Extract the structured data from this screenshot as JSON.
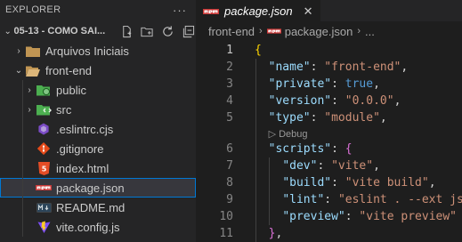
{
  "explorer": {
    "title": "EXPLORER",
    "more_label": "···",
    "project_name": "05-13 - COMO SAI...",
    "actions": [
      "new-file-icon",
      "new-folder-icon",
      "refresh-icon",
      "collapse-all-icon"
    ],
    "tree": [
      {
        "label": "Arquivos Iniciais",
        "icon": "folder-icon",
        "chevron": "›"
      },
      {
        "label": "front-end",
        "icon": "folder-open-icon",
        "chevron": "⌄"
      },
      {
        "label": "public",
        "icon": "public-folder-icon",
        "chevron": "›"
      },
      {
        "label": "src",
        "icon": "src-folder-icon",
        "chevron": "›"
      },
      {
        "label": ".eslintrc.cjs",
        "icon": "eslint-icon",
        "chevron": ""
      },
      {
        "label": ".gitignore",
        "icon": "git-icon",
        "chevron": ""
      },
      {
        "label": "index.html",
        "icon": "html-icon",
        "chevron": ""
      },
      {
        "label": "package.json",
        "icon": "npm-icon",
        "chevron": ""
      },
      {
        "label": "README.md",
        "icon": "markdown-icon",
        "chevron": ""
      },
      {
        "label": "vite.config.js",
        "icon": "vite-icon",
        "chevron": ""
      }
    ]
  },
  "tab": {
    "label": "package.json",
    "close": "✕"
  },
  "breadcrumb": [
    "front-end",
    "package.json",
    "..."
  ],
  "codelens": "▷ Debug",
  "lines": [
    {
      "n": "1",
      "tokens": [
        {
          "t": "{",
          "c": "brace1"
        }
      ]
    },
    {
      "n": "2",
      "tokens": [
        {
          "t": "  "
        },
        {
          "t": "\"name\"",
          "c": "key"
        },
        {
          "t": ": ",
          "c": "pn"
        },
        {
          "t": "\"front-end\"",
          "c": "str"
        },
        {
          "t": ",",
          "c": "pn"
        }
      ]
    },
    {
      "n": "3",
      "tokens": [
        {
          "t": "  "
        },
        {
          "t": "\"private\"",
          "c": "key"
        },
        {
          "t": ": ",
          "c": "pn"
        },
        {
          "t": "true",
          "c": "kw"
        },
        {
          "t": ",",
          "c": "pn"
        }
      ]
    },
    {
      "n": "4",
      "tokens": [
        {
          "t": "  "
        },
        {
          "t": "\"version\"",
          "c": "key"
        },
        {
          "t": ": ",
          "c": "pn"
        },
        {
          "t": "\"0.0.0\"",
          "c": "str"
        },
        {
          "t": ",",
          "c": "pn"
        }
      ]
    },
    {
      "n": "5",
      "tokens": [
        {
          "t": "  "
        },
        {
          "t": "\"type\"",
          "c": "key"
        },
        {
          "t": ": ",
          "c": "pn"
        },
        {
          "t": "\"module\"",
          "c": "str"
        },
        {
          "t": ",",
          "c": "pn"
        }
      ]
    },
    {
      "n": "6",
      "tokens": [
        {
          "t": "  "
        },
        {
          "t": "\"scripts\"",
          "c": "key"
        },
        {
          "t": ": ",
          "c": "pn"
        },
        {
          "t": "{",
          "c": "brace2"
        }
      ]
    },
    {
      "n": "7",
      "tokens": [
        {
          "t": "    "
        },
        {
          "t": "\"dev\"",
          "c": "key"
        },
        {
          "t": ": ",
          "c": "pn"
        },
        {
          "t": "\"vite\"",
          "c": "str"
        },
        {
          "t": ",",
          "c": "pn"
        }
      ]
    },
    {
      "n": "8",
      "tokens": [
        {
          "t": "    "
        },
        {
          "t": "\"build\"",
          "c": "key"
        },
        {
          "t": ": ",
          "c": "pn"
        },
        {
          "t": "\"vite build\"",
          "c": "str"
        },
        {
          "t": ",",
          "c": "pn"
        }
      ]
    },
    {
      "n": "9",
      "tokens": [
        {
          "t": "    "
        },
        {
          "t": "\"lint\"",
          "c": "key"
        },
        {
          "t": ": ",
          "c": "pn"
        },
        {
          "t": "\"eslint . --ext js",
          "c": "str"
        }
      ]
    },
    {
      "n": "10",
      "tokens": [
        {
          "t": "    "
        },
        {
          "t": "\"preview\"",
          "c": "key"
        },
        {
          "t": ": ",
          "c": "pn"
        },
        {
          "t": "\"vite preview\"",
          "c": "str"
        }
      ]
    },
    {
      "n": "11",
      "tokens": [
        {
          "t": "  "
        },
        {
          "t": "}",
          "c": "brace2"
        },
        {
          "t": ",",
          "c": "pn"
        }
      ]
    }
  ],
  "active_line": "1",
  "colors": {
    "accent": "#0078d4",
    "key": "#9cdcfe",
    "string": "#ce9178",
    "keyword": "#569cd6",
    "brace1": "#ffd700",
    "brace2": "#da70d6"
  }
}
